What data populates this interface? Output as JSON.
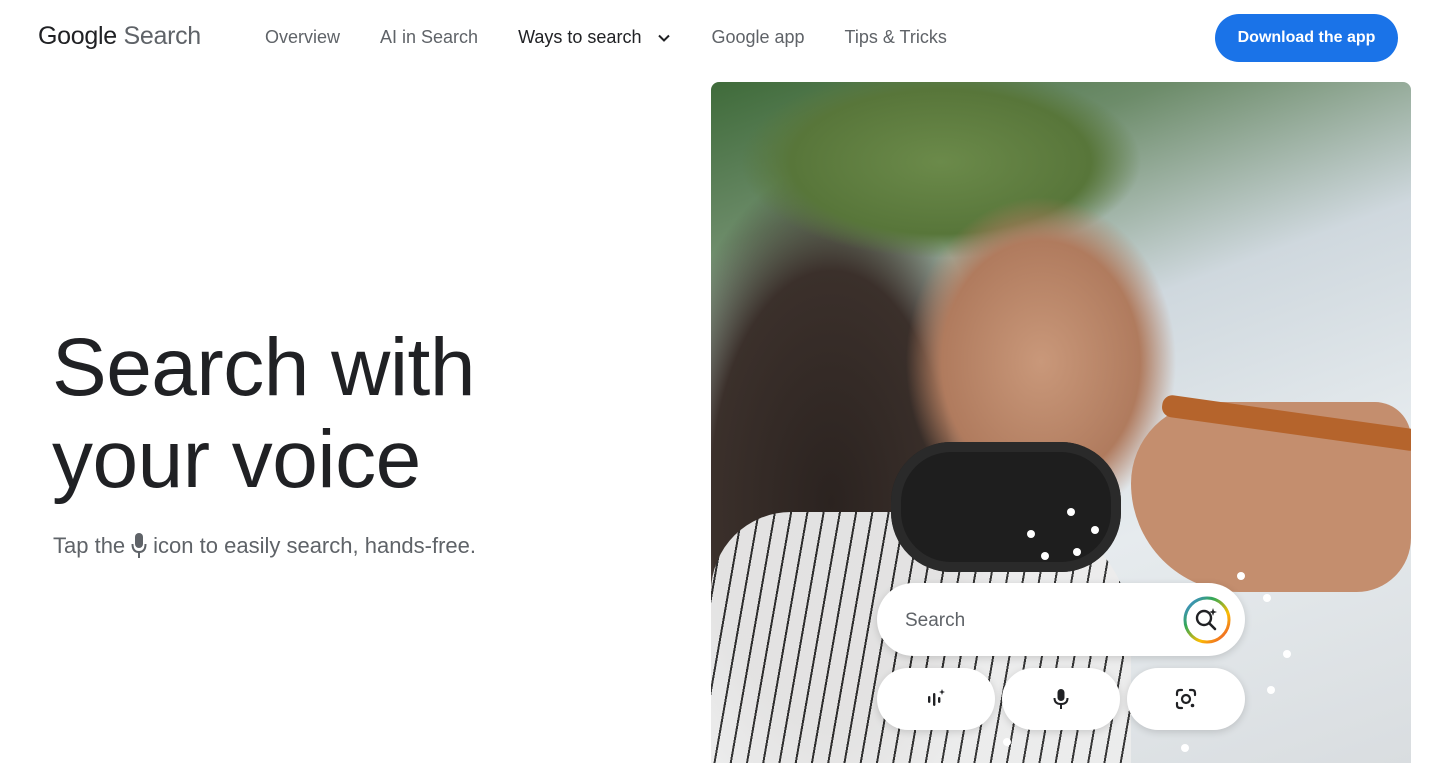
{
  "header": {
    "logo_google": "Google",
    "logo_search": "Search",
    "nav": [
      {
        "label": "Overview"
      },
      {
        "label": "AI in Search"
      },
      {
        "label": "Ways to search"
      },
      {
        "label": "Google app"
      },
      {
        "label": "Tips & Tricks"
      }
    ],
    "cta_label": "Download the app"
  },
  "hero": {
    "headline_line1": "Search with",
    "headline_line2": "your voice",
    "sub_before": "Tap the",
    "sub_after": "icon to easily search, hands-free."
  },
  "search_overlay": {
    "placeholder": "Search",
    "icons": [
      "google-lens-sparkle-icon",
      "voice-waveform-icon",
      "microphone-icon",
      "camera-lens-icon"
    ]
  },
  "colors": {
    "primary": "#1a73e8",
    "text": "#202124",
    "muted": "#5f6368"
  }
}
